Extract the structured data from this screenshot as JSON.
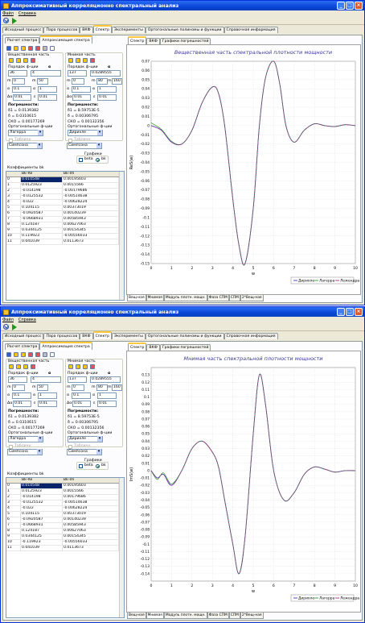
{
  "window": {
    "title": "Аппроксимативный корреляционно спектральный анализ",
    "menu": [
      "Файл",
      "Справка"
    ]
  },
  "main_tabs": [
    "Исходный процесс",
    "Пара процессов",
    "ВКФ",
    "Спектр",
    "Эксперименты",
    "Ортогональные полиномы и функции",
    "Справочная информация"
  ],
  "sub_tabs": [
    "Расчет спектра",
    "Аппроксимация спектра"
  ],
  "chart_tabs": [
    "Спектр",
    "ВКФ",
    "Графики погрешностей"
  ],
  "bottom_tabs": [
    "Вещ-ная",
    "Мнимая",
    "Модуль плотн. мощн.",
    "Фаза СПМ",
    "СПМ",
    "2*Вещ-ная"
  ],
  "left": {
    "real_group": "Вещественная часть",
    "imag_group": "Мнимая часть",
    "order_label": "Порядок ф-ции",
    "alpha": "α",
    "real": {
      "order": "36",
      "alpha": "4",
      "m_min": "0",
      "m_max": "50",
      "a_min": "0.1",
      "a_max": "1",
      "da": "0.01",
      "eps": "0.01",
      "err_title": "Погрешности:",
      "delta1": "δ1 = 0.0139382",
      "delta": "δ = 0.0310615",
      "sko": "СКО = 0.00177269",
      "orth_label": "Ортогональные ф-ции",
      "orth_value": "Лагерра",
      "tables_label": "Табличн",
      "method_value": "Симпсона"
    },
    "imag": {
      "order": "137",
      "alpha": "0.0289555",
      "m_min": "0",
      "m_max": "80",
      "m_max2": "160",
      "a_min": "0.1",
      "a_max": "1",
      "da": "0.01",
      "eps": "0.01",
      "err_title": "Погрешности:",
      "delta1": "δ1 = 8.59753Е-5",
      "delta": "δ = 0.00306795",
      "sko": "СКО = 0.00132356",
      "orth_label": "Ортогональные ф-ции",
      "orth_value": "Дирихле",
      "tables_label": "Табличн",
      "method_value": "Симпсона"
    },
    "graphs_label": "Графики",
    "graphs_options": [
      "beta",
      "bk"
    ],
    "coeff_title": "Коэффициенты bk",
    "table_cols": [
      "",
      "Bk-Re",
      "Bk-Im"
    ],
    "rows_1": [
      [
        "0",
        "0.010548",
        "0.00195603"
      ],
      [
        "1",
        "0.0125923",
        "0.0015566"
      ],
      [
        "2",
        "-0.014198",
        "-0.00179686"
      ],
      [
        "3",
        "-0.0125532",
        "-0.00514638"
      ],
      [
        "4",
        "-0.022",
        "-0.00628224"
      ],
      [
        "5",
        "0.104115",
        "0.00373019"
      ],
      [
        "6",
        "-0.0920587",
        "0.00140239"
      ],
      [
        "7",
        "-0.0668931",
        "0.00585943"
      ],
      [
        "8",
        "0.124187",
        "0.00627063"
      ],
      [
        "9",
        "0.0344125",
        "0.00154345"
      ],
      [
        "10",
        "0.119923",
        "-0.00556033"
      ],
      [
        "11",
        "0.041039",
        "0.0113673"
      ]
    ],
    "rows_2": [
      [
        "0",
        "0.010548",
        "0.00195603"
      ],
      [
        "1",
        "0.0125923",
        "0.0015566"
      ],
      [
        "2",
        "-0.014198",
        "0.00179686"
      ],
      [
        "3",
        "-0.0125532",
        "-0.00514638"
      ],
      [
        "4",
        "-0.022",
        "-0.00628224"
      ],
      [
        "5",
        "0.104115",
        "0.00373019"
      ],
      [
        "6",
        "-0.0920587",
        "0.00140239"
      ],
      [
        "7",
        "-0.0668931",
        "0.00585943"
      ],
      [
        "8",
        "0.124187",
        "0.00627063"
      ],
      [
        "9",
        "0.0344125",
        "0.00154345"
      ],
      [
        "10",
        "-0.119923",
        "-0.00556033"
      ],
      [
        "11",
        "0.041039",
        "0.0113673"
      ]
    ]
  },
  "colors": {
    "dirichlet": "#3a3ad0",
    "laguerre": "#2e9a2e",
    "legendre": "#b02a8a",
    "title": "#3a3a9a"
  },
  "chart_data": [
    {
      "type": "line",
      "title": "Вещественная часть спектральной плотности мощности",
      "xlabel": "w",
      "ylabel": "ReS(w)",
      "xlim": [
        0,
        10
      ],
      "ylim": [
        -0.15,
        0.07
      ],
      "xticks": [
        0,
        1,
        2,
        3,
        4,
        5,
        6,
        7,
        8,
        9,
        10
      ],
      "yticks": [
        0.07,
        0.06,
        0.05,
        0.04,
        0.03,
        0.02,
        0.01,
        0,
        -0.01,
        -0.02,
        -0.03,
        -0.04,
        -0.05,
        -0.06,
        -0.07,
        -0.08,
        -0.09,
        -0.1,
        -0.11,
        -0.12,
        -0.13,
        -0.14,
        -0.15
      ],
      "grid": true,
      "legend": "bottom-right",
      "series": [
        {
          "name": "Дирихле",
          "x": [
            0,
            0.5,
            1,
            1.5,
            2,
            2.5,
            3,
            3.3,
            3.6,
            4,
            4.3,
            4.6,
            5,
            5.3,
            5.6,
            6,
            6.3,
            6.6,
            7,
            7.5,
            8,
            8.5,
            9,
            9.5,
            10
          ],
          "values": [
            0.0,
            -0.005,
            -0.018,
            -0.02,
            -0.005,
            0.025,
            0.042,
            0.035,
            0.0,
            -0.08,
            -0.13,
            -0.15,
            -0.09,
            0.0,
            0.052,
            0.07,
            0.045,
            0.0,
            -0.018,
            -0.005,
            0.002,
            0.0,
            -0.001,
            0.001,
            0.0
          ]
        },
        {
          "name": "Лагерра",
          "x": [
            0,
            0.5,
            1,
            1.5,
            2,
            2.5,
            3,
            3.3,
            3.6,
            4,
            4.3,
            4.6,
            5,
            5.3,
            5.6,
            6,
            6.3,
            6.6,
            7,
            7.5,
            8,
            8.5,
            9,
            9.5,
            10
          ],
          "values": [
            0.003,
            -0.004,
            -0.017,
            -0.02,
            -0.005,
            0.025,
            0.042,
            0.035,
            0.0,
            -0.08,
            -0.13,
            -0.15,
            -0.09,
            0.0,
            0.052,
            0.07,
            0.045,
            0.0,
            -0.018,
            -0.005,
            0.002,
            0.0,
            -0.001,
            0.001,
            0.0
          ]
        },
        {
          "name": "Лежендра",
          "x": [
            0,
            0.5,
            1,
            1.5,
            2,
            2.5,
            3,
            3.3,
            3.6,
            4,
            4.3,
            4.6,
            5,
            5.3,
            5.6,
            6,
            6.3,
            6.6,
            7,
            7.5,
            8,
            8.5,
            9,
            9.5,
            10
          ],
          "values": [
            0.0,
            -0.005,
            -0.018,
            -0.02,
            -0.005,
            0.025,
            0.042,
            0.035,
            0.0,
            -0.08,
            -0.13,
            -0.15,
            -0.09,
            0.0,
            0.052,
            0.07,
            0.045,
            0.0,
            -0.018,
            -0.005,
            0.002,
            0.0,
            -0.001,
            0.001,
            0.0
          ]
        }
      ]
    },
    {
      "type": "line",
      "title": "Мнимая часть спектральной плотности мощности",
      "xlabel": "w",
      "ylabel": "ImS(w)",
      "xlim": [
        0,
        10
      ],
      "ylim": [
        -0.15,
        0.14
      ],
      "xticks": [
        0,
        1,
        2,
        3,
        4,
        5,
        6,
        7,
        8,
        9,
        10
      ],
      "yticks": [
        0.13,
        0.12,
        0.11,
        0.1,
        0.09,
        0.08,
        0.07,
        0.06,
        0.05,
        0.04,
        0.03,
        0.02,
        0.01,
        0,
        -0.01,
        -0.02,
        -0.03,
        -0.04,
        -0.05,
        -0.06,
        -0.07,
        -0.08,
        -0.09,
        -0.1,
        -0.11,
        -0.12,
        -0.13,
        -0.14
      ],
      "grid": true,
      "legend": "bottom-right",
      "series": [
        {
          "name": "Дирихле",
          "x": [
            0,
            0.3,
            0.6,
            1,
            1.5,
            2,
            2.5,
            3,
            3.3,
            3.6,
            4,
            4.3,
            4.6,
            5,
            5.3,
            5.6,
            6,
            6.5,
            7,
            7.5,
            8,
            8.5,
            9,
            9.5,
            10
          ],
          "values": [
            0.0,
            -0.01,
            -0.005,
            -0.02,
            0.0,
            0.03,
            0.04,
            0.025,
            0.005,
            -0.04,
            -0.1,
            -0.14,
            -0.09,
            0.05,
            0.13,
            0.09,
            0.0,
            -0.04,
            -0.03,
            -0.005,
            0.005,
            0.002,
            -0.002,
            0.0,
            0.0
          ]
        },
        {
          "name": "Лагерра",
          "x": [
            0,
            0.3,
            0.6,
            1,
            1.5,
            2,
            2.5,
            3,
            3.3,
            3.6,
            4,
            4.3,
            4.6,
            5,
            5.3,
            5.6,
            6,
            6.5,
            7,
            7.5,
            8,
            8.5,
            9,
            9.5,
            10
          ],
          "values": [
            0.0,
            -0.012,
            -0.003,
            -0.018,
            0.0,
            0.03,
            0.04,
            0.025,
            0.005,
            -0.04,
            -0.1,
            -0.14,
            -0.09,
            0.05,
            0.13,
            0.09,
            0.0,
            -0.04,
            -0.03,
            -0.005,
            0.005,
            0.002,
            -0.002,
            0.0,
            0.0
          ]
        },
        {
          "name": "Лежендра",
          "x": [
            0,
            0.3,
            0.6,
            1,
            1.5,
            2,
            2.5,
            3,
            3.3,
            3.6,
            4,
            4.3,
            4.6,
            5,
            5.3,
            5.6,
            6,
            6.5,
            7,
            7.5,
            8,
            8.5,
            9,
            9.5,
            10
          ],
          "values": [
            0.0,
            -0.01,
            -0.005,
            -0.02,
            0.0,
            0.03,
            0.04,
            0.025,
            0.005,
            -0.04,
            -0.1,
            -0.14,
            -0.09,
            0.05,
            0.13,
            0.09,
            0.0,
            -0.04,
            -0.03,
            -0.005,
            0.005,
            0.002,
            -0.002,
            0.0,
            0.0
          ]
        }
      ]
    }
  ]
}
